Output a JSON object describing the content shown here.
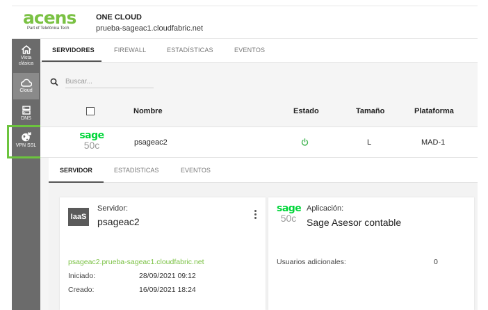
{
  "header": {
    "logo_text": "acens",
    "logo_sub": "Part of Telefónica Tech",
    "project_title": "ONE CLOUD",
    "project_domain": "prueba-sageac1.cloudfabric.net"
  },
  "sidebar": {
    "items": [
      {
        "label_line1": "Vista",
        "label_line2": "clásica",
        "icon": "home-icon"
      },
      {
        "label_line1": "Cloud",
        "label_line2": "",
        "icon": "cloud-icon",
        "active": true
      },
      {
        "label_line1": "DNS",
        "label_line2": "",
        "icon": "dns-icon"
      },
      {
        "label_line1": "VPN SSL",
        "label_line2": "",
        "icon": "vpn-globe-icon"
      }
    ]
  },
  "main_tabs": [
    "SERVIDORES",
    "FIREWALL",
    "ESTADÍSTICAS",
    "EVENTOS"
  ],
  "search": {
    "placeholder": "Buscar..."
  },
  "table": {
    "headers": {
      "name": "Nombre",
      "state": "Estado",
      "size": "Tamaño",
      "platform": "Plataforma"
    },
    "rows": [
      {
        "logo_word": "sage",
        "logo_num": "50c",
        "name": "psageac2",
        "state_icon": "power-icon",
        "size": "L",
        "platform": "MAD-1"
      }
    ]
  },
  "detail_tabs": [
    "SERVIDOR",
    "ESTADÍSTICAS",
    "EVENTOS"
  ],
  "server_card": {
    "badge": "IaaS",
    "label": "Servidor:",
    "name": "psageac2",
    "fqdn": "psageac2.prueba-sageac1.cloudfabric.net",
    "started_label": "Iniciado:",
    "started_value": "28/09/2021 09:12",
    "created_label": "Creado:",
    "created_value": "16/09/2021 18:24"
  },
  "app_card": {
    "logo_word": "sage",
    "logo_num": "50c",
    "label": "Aplicación:",
    "name": "Sage Asesor contable",
    "extra_users_label": "Usuarios adicionales:",
    "extra_users_value": "0"
  },
  "colors": {
    "accent": "#7ac143",
    "sage_green": "#00d639",
    "sidebar": "#6b6b6b",
    "highlight": "#6cc43e"
  }
}
